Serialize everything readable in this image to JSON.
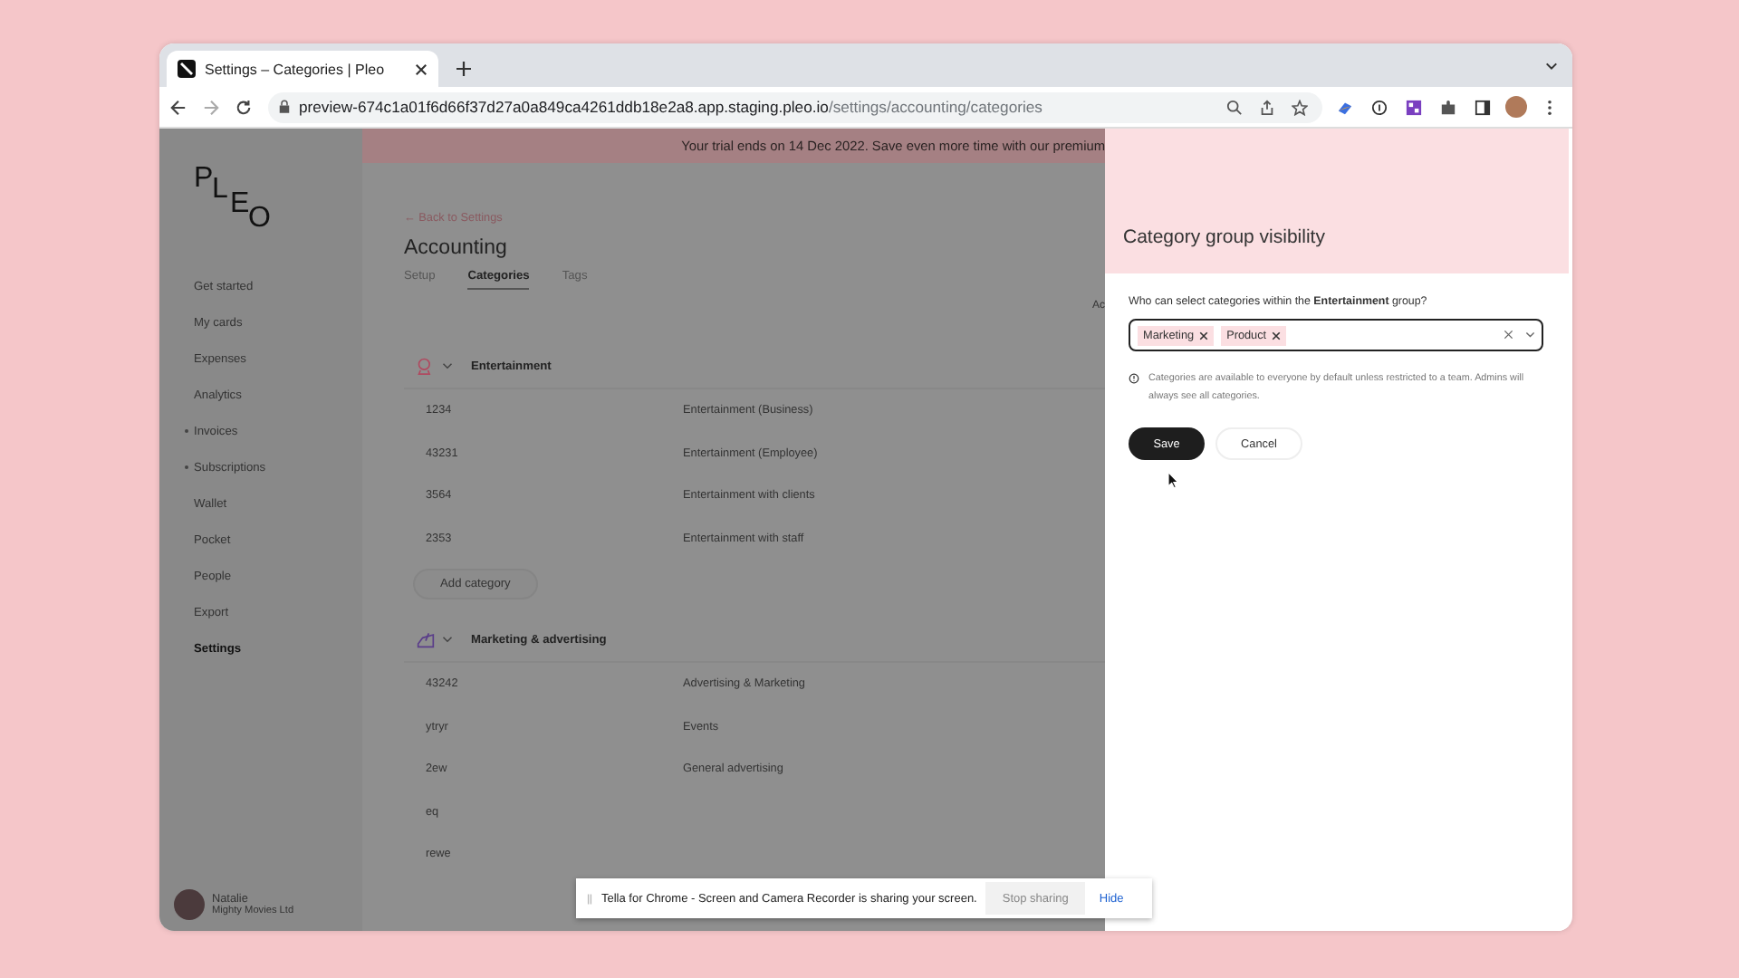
{
  "browser": {
    "tab_title": "Settings – Categories | Pleo",
    "url_host": "preview-674c1a01f6d66f37d27a0a849ca4261ddb18e2a8.app.staging.pleo.io",
    "url_path": "/settings/accounting/categories"
  },
  "banner": {
    "text": "Your trial ends on 14 Dec 2022. Save even more time with our premium"
  },
  "sidebar": {
    "logo": "PLEO",
    "items": [
      {
        "label": "Get started",
        "selected": false,
        "dot": false
      },
      {
        "label": "My cards",
        "selected": false,
        "dot": false
      },
      {
        "label": "Expenses",
        "selected": false,
        "dot": false
      },
      {
        "label": "Analytics",
        "selected": false,
        "dot": false
      },
      {
        "label": "Invoices",
        "selected": false,
        "dot": true
      },
      {
        "label": "Subscriptions",
        "selected": false,
        "dot": true
      },
      {
        "label": "Wallet",
        "selected": false,
        "dot": false
      },
      {
        "label": "Pocket",
        "selected": false,
        "dot": false
      },
      {
        "label": "People",
        "selected": false,
        "dot": false
      },
      {
        "label": "Export",
        "selected": false,
        "dot": false
      },
      {
        "label": "Settings",
        "selected": true,
        "dot": false
      }
    ],
    "user": {
      "name": "Natalie",
      "company": "Mighty Movies Ltd"
    }
  },
  "main": {
    "back_link": "← Back to Settings",
    "title": "Accounting",
    "tabs": [
      {
        "label": "Setup",
        "selected": false
      },
      {
        "label": "Categories",
        "selected": true
      },
      {
        "label": "Tags",
        "selected": false
      }
    ],
    "column_cut": "Ac",
    "groups": [
      {
        "kind": "entertainment",
        "name": "Entertainment",
        "rows": [
          {
            "code": "1234",
            "name": "Entertainment (Business)"
          },
          {
            "code": "43231",
            "name": "Entertainment (Employee)"
          },
          {
            "code": "3564",
            "name": "Entertainment with clients"
          },
          {
            "code": "2353",
            "name": "Entertainment with staff"
          }
        ],
        "add_button": "Add category"
      },
      {
        "kind": "marketing",
        "name": "Marketing & advertising",
        "rows": [
          {
            "code": "43242",
            "name": "Advertising & Marketing"
          },
          {
            "code": "ytryr",
            "name": "Events"
          },
          {
            "code": "2ew",
            "name": "General advertising"
          },
          {
            "code": "eq",
            "name": ""
          },
          {
            "code": "rewe",
            "name": ""
          }
        ]
      }
    ]
  },
  "panel": {
    "title": "Category group visibility",
    "question": "Who can select categories within the **Entertainment** group?",
    "tags": [
      "Marketing",
      "Product"
    ],
    "note": "Categories are available to everyone by default unless restricted to a team. Admins will always see all categories.",
    "save": "Save",
    "cancel": "Cancel"
  },
  "share_bar": {
    "text": "Tella for Chrome - Screen and Camera Recorder is sharing your screen.",
    "stop": "Stop sharing",
    "hide": "Hide"
  }
}
